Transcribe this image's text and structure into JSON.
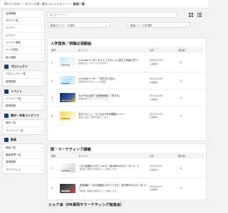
{
  "breadcrumb": {
    "root": "PRマイスター・スクール第一期生コミュニティー",
    "separator": ">",
    "current": "動画一覧"
  },
  "sidebar": {
    "group_main": [
      {
        "label": "会員情報"
      },
      {
        "label": "タスク一覧"
      },
      {
        "label": "メンバー"
      },
      {
        "label": "ピアサー"
      },
      {
        "label": "メンバー属性"
      },
      {
        "label": "メール配信"
      },
      {
        "label": "個人情報"
      }
    ],
    "section_project": {
      "title": "プロジェクト",
      "items": [
        {
          "label": "プロジェクト一覧"
        },
        {
          "label": "新規登録"
        }
      ]
    },
    "section_event": {
      "title": "イベント",
      "items": [
        {
          "label": "イベント一覧"
        },
        {
          "label": "新規登録"
        }
      ]
    },
    "section_content": {
      "title": "教材・共有コンテンツ",
      "items": [
        {
          "label": "教材一覧"
        },
        {
          "label": "コンテンツ一覧"
        }
      ]
    },
    "section_video": {
      "title": "動画",
      "items": [
        {
          "label": "動画一覧"
        },
        {
          "label": "動画管理一覧"
        },
        {
          "label": "新規登録"
        },
        {
          "label": "プラクティス"
        }
      ]
    }
  },
  "search": {
    "placeholder": "キーワード",
    "value": ""
  },
  "filters": {
    "category": "動画カテゴリーを選択",
    "series": "動画シリーズを選択"
  },
  "table_headers": {
    "number": "番号",
    "title": "タイトル",
    "date": "日付",
    "plays": "再生数"
  },
  "section1": {
    "title": "入学直後／視聴必須動画",
    "rows": [
      {
        "number": "1",
        "title": "1/1.Noteライター＆ライフスタイルに役立ち情報入門 ①",
        "sub": "知識を身につけてプロの世界へ",
        "date": "2022/11/26",
        "date2": "(公開中)",
        "plays": "0"
      },
      {
        "number": "2",
        "title": "2/2.Noteライター「書き方と流れ」",
        "sub": "初級者向けのポイントを解説",
        "date": "2022/11/26",
        "date2": "(公開中)",
        "plays": "1"
      },
      {
        "number": "3",
        "title": "3/3.PRを活用する基礎知識と「書き方」",
        "sub": "基礎を押さえてステップアップ",
        "date": "2022/11/26",
        "date2": "(公開中)",
        "plays": "1"
      },
      {
        "number": "4",
        "title": "あなたもニュースになる100本開催セミナー",
        "sub": "実践に役立つ事例を紹介します",
        "date": "2022/11/26",
        "date2": "(公開中)",
        "plays": "0"
      }
    ]
  },
  "section2": {
    "title": "群・マーケティング講義",
    "rows": [
      {
        "number": "1",
        "title": "一生の武器を10分でつかむ！成功率50%のすゝめ ルーツ",
        "sub": "【前編】講義の内容をもとに解説します",
        "date": "2022/11/21",
        "date2": "(公開中)",
        "plays": "0"
      },
      {
        "number": "2",
        "title": "【前回編】一生の武器を10分でつかむ！成功率50%のすゝめ ルーツ",
        "sub": "【後編】講義の内容をもとに解説します",
        "date": "2022/11/21",
        "date2": "(公開中)",
        "plays": "0"
      }
    ]
  },
  "section3": {
    "title": "シェア会（PR事例やマーケティング勉強会）"
  }
}
